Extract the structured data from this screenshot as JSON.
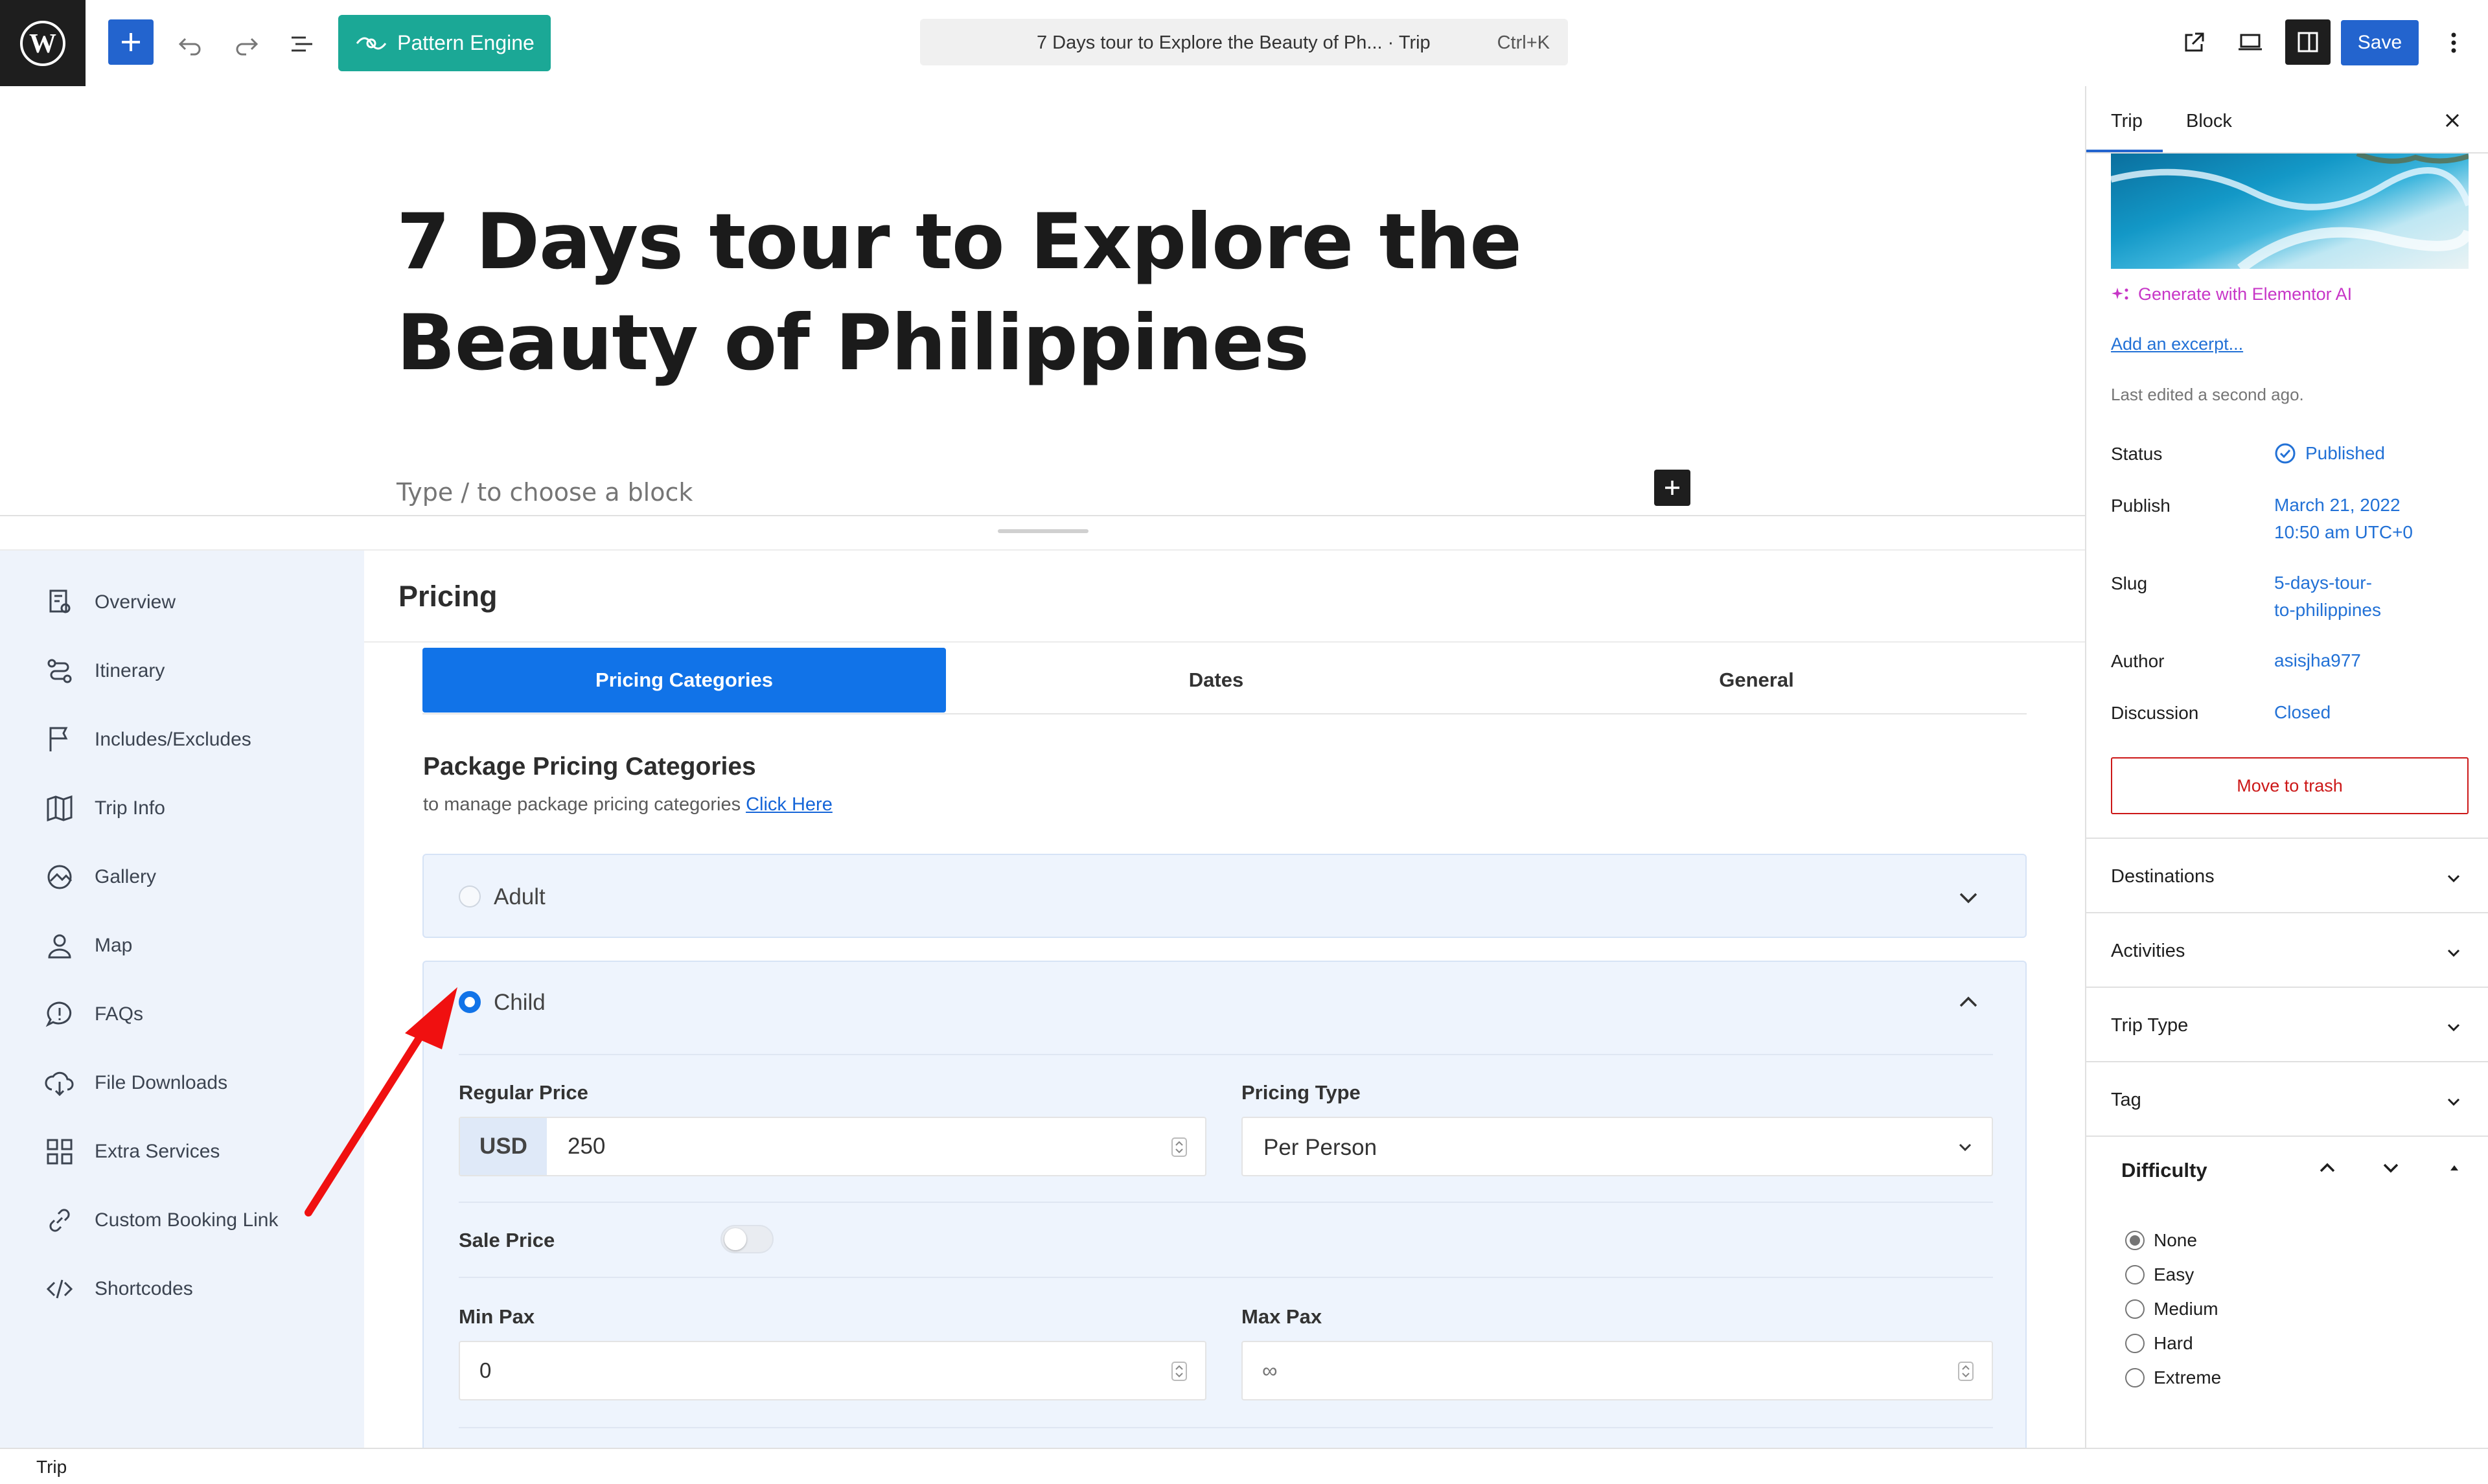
{
  "topbar": {
    "pattern_engine_label": "Pattern Engine",
    "document_title": "7 Days tour to Explore the Beauty of Ph... · Trip",
    "shortcut": "Ctrl+K",
    "save_label": "Save"
  },
  "editor": {
    "post_title": "7 Days tour to Explore the Beauty of Philippines",
    "block_placeholder": "Type / to choose a block"
  },
  "meta_nav": {
    "items": [
      {
        "label": "Overview",
        "icon": "overview-icon"
      },
      {
        "label": "Itinerary",
        "icon": "itinerary-icon"
      },
      {
        "label": "Includes/Excludes",
        "icon": "includes-icon"
      },
      {
        "label": "Trip Info",
        "icon": "map-fold-icon"
      },
      {
        "label": "Gallery",
        "icon": "gallery-icon"
      },
      {
        "label": "Map",
        "icon": "map-pin-icon"
      },
      {
        "label": "FAQs",
        "icon": "faq-icon"
      },
      {
        "label": "File Downloads",
        "icon": "download-icon"
      },
      {
        "label": "Extra Services",
        "icon": "grid-icon"
      },
      {
        "label": "Custom Booking Link",
        "icon": "link-icon"
      },
      {
        "label": "Shortcodes",
        "icon": "code-icon"
      }
    ]
  },
  "pricing": {
    "heading": "Pricing",
    "tabs": [
      "Pricing Categories",
      "Dates",
      "General"
    ],
    "section_title": "Package Pricing Categories",
    "section_desc": "to manage package pricing categories",
    "section_link": "Click Here",
    "categories": [
      {
        "label": "Adult",
        "selected": false,
        "expanded": false
      },
      {
        "label": "Child",
        "selected": true,
        "expanded": true
      }
    ],
    "child": {
      "regular_price_label": "Regular Price",
      "currency": "USD",
      "regular_price": "250",
      "pricing_type_label": "Pricing Type",
      "pricing_type": "Per Person",
      "sale_price_label": "Sale Price",
      "sale_price_enabled": false,
      "min_pax_label": "Min Pax",
      "min_pax": "0",
      "max_pax_label": "Max Pax",
      "max_pax_placeholder": "∞"
    }
  },
  "sidebar": {
    "tabs": [
      "Trip",
      "Block"
    ],
    "generate_ai": "Generate with Elementor AI",
    "add_excerpt": "Add an excerpt...",
    "last_edited": "Last edited a second ago.",
    "status_label": "Status",
    "status_value": "Published",
    "publish_label": "Publish",
    "publish_date": "March 21, 2022",
    "publish_time": "10:50 am UTC+0",
    "slug_label": "Slug",
    "slug_line1": "5-days-tour-",
    "slug_line2": "to-philippines",
    "author_label": "Author",
    "author_value": "asisjha977",
    "discussion_label": "Discussion",
    "discussion_value": "Closed",
    "trash_label": "Move to trash",
    "panels": [
      "Destinations",
      "Activities",
      "Trip Type",
      "Tag"
    ],
    "difficulty": {
      "title": "Difficulty",
      "options": [
        "None",
        "Easy",
        "Medium",
        "Hard",
        "Extreme"
      ],
      "selected": "None"
    }
  },
  "footer": {
    "breadcrumb": "Trip"
  },
  "colors": {
    "accent": "#1173e8",
    "wp_blue": "#2364ce",
    "pattern_green": "#1ba896",
    "danger": "#cc1818",
    "ai_pink": "#c736c7"
  }
}
